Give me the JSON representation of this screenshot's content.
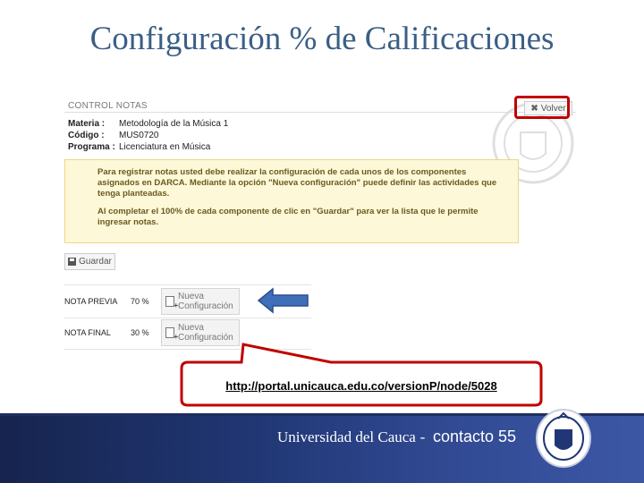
{
  "slide": {
    "title": "Configuración % de Calificaciones"
  },
  "panel": {
    "title": "CONTROL NOTAS",
    "back_button": "Volver",
    "info": [
      {
        "label": "Materia :",
        "value": "Metodología de la Música 1"
      },
      {
        "label": "Código :",
        "value": "MUS0720"
      },
      {
        "label": "Programa :",
        "value": "Licenciatura en Música"
      }
    ],
    "notice": {
      "paragraph1": "Para registrar notas usted debe realizar la configuración de cada unos de los componentes asignados en DARCA. Mediante la opción \"Nueva configuración\" puede definir las actividades que tenga planteadas.",
      "paragraph2": "Al completar el 100% de cada componente de clic en \"Guardar\" para ver la lista que le permite ingresar notas."
    },
    "save_button": "Guardar",
    "grades": [
      {
        "name": "NOTA PREVIA",
        "percent": "70 %",
        "button_line1": "Nueva",
        "button_line2": "Configuración"
      },
      {
        "name": "NOTA FINAL",
        "percent": "30 %",
        "button_line1": "Nueva",
        "button_line2": "Configuración"
      }
    ]
  },
  "callout": {
    "url": "http://portal.unicauca.edu.co/versionP/node/5028"
  },
  "footer": {
    "university": "Universidad del Cauca",
    "separator": "-",
    "contact": "contacto 55"
  },
  "colors": {
    "title": "#3a5f86",
    "highlight": "#c00000",
    "notice_bg": "#fcf8d8",
    "footer_bg": "#213775",
    "arrow": "#3f6fb8"
  }
}
